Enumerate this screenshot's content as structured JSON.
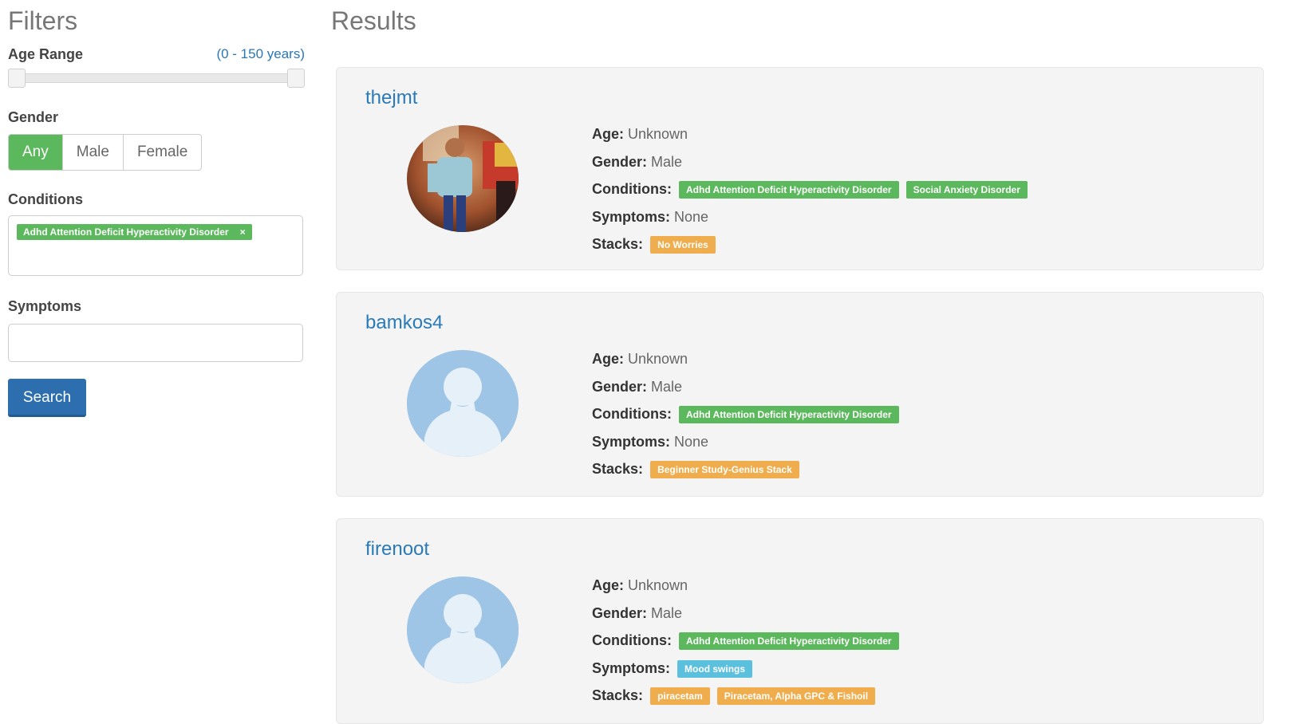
{
  "sidebar": {
    "title": "Filters",
    "age_range": {
      "label": "Age Range",
      "value": "(0 - 150 years)",
      "min": 0,
      "max": 150,
      "selected_min": 0,
      "selected_max": 150
    },
    "gender": {
      "label": "Gender",
      "options": [
        "Any",
        "Male",
        "Female"
      ],
      "selected": "Any"
    },
    "conditions": {
      "label": "Conditions",
      "selected_tags": [
        "Adhd Attention Deficit Hyperactivity Disorder"
      ],
      "remove_glyph": "×"
    },
    "symptoms": {
      "label": "Symptoms",
      "value": ""
    },
    "search_label": "Search"
  },
  "results": {
    "title": "Results",
    "labels": {
      "age": "Age:",
      "gender": "Gender:",
      "conditions": "Conditions:",
      "symptoms": "Symptoms:",
      "stacks": "Stacks:"
    },
    "items": [
      {
        "username": "thejmt",
        "avatar": "photo",
        "age": "Unknown",
        "gender": "Male",
        "conditions": [
          "Adhd Attention Deficit Hyperactivity Disorder",
          "Social Anxiety Disorder"
        ],
        "symptoms_text": "None",
        "symptoms": [],
        "stacks": [
          "No Worries"
        ]
      },
      {
        "username": "bamkos4",
        "avatar": "default-silhouette",
        "age": "Unknown",
        "gender": "Male",
        "conditions": [
          "Adhd Attention Deficit Hyperactivity Disorder"
        ],
        "symptoms_text": "None",
        "symptoms": [],
        "stacks": [
          "Beginner Study-Genius Stack"
        ]
      },
      {
        "username": "firenoot",
        "avatar": "default-silhouette",
        "age": "Unknown",
        "gender": "Male",
        "conditions": [
          "Adhd Attention Deficit Hyperactivity Disorder"
        ],
        "symptoms_text": "",
        "symptoms": [
          "Mood swings"
        ],
        "stacks": [
          "piracetam",
          "Piracetam, Alpha GPC & Fishoil"
        ]
      }
    ]
  },
  "colors": {
    "accent_blue": "#2a7ab8",
    "condition_green": "#5cb85c",
    "stack_orange": "#f0ad4e",
    "symptom_blue": "#5bc0de",
    "button_blue": "#2d6fae"
  }
}
